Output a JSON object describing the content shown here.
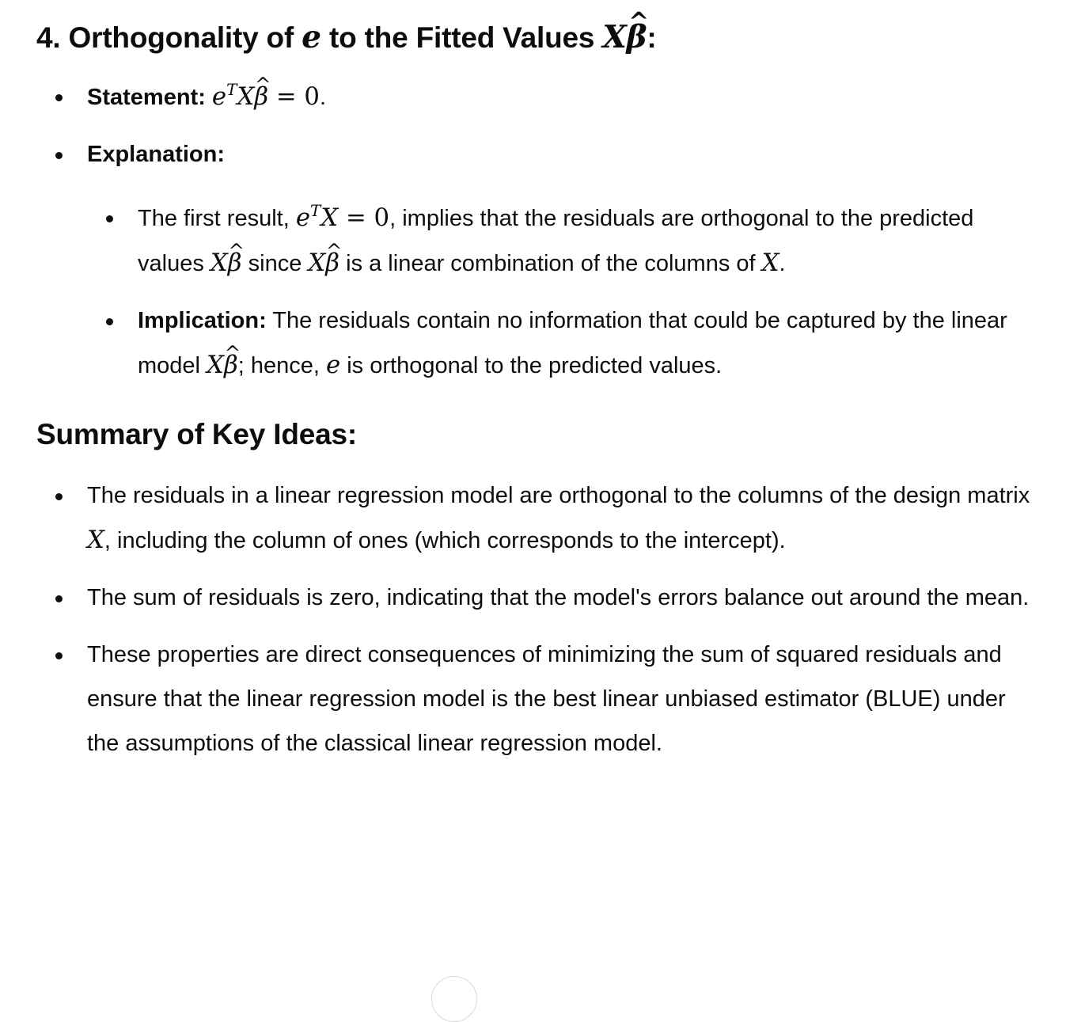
{
  "section4": {
    "heading_prefix": "4. Orthogonality of ",
    "heading_var": "e",
    "heading_mid": " to the Fitted Values ",
    "heading_math_X": "X",
    "heading_math_beta": "β",
    "heading_suffix": ":",
    "statement": {
      "label": "Statement:",
      "math_e": "e",
      "math_sup": "T",
      "math_X": "X",
      "math_beta": "β",
      "math_eq": " = 0",
      "suffix": "."
    },
    "explanation": {
      "label": "Explanation:",
      "items": [
        {
          "t1": "The first result, ",
          "m1_e": "e",
          "m1_sup": "T",
          "m1_X": "X",
          "m1_eq": " = 0",
          "t2": ", implies that the residuals are orthogonal to the predicted values ",
          "m2_X": "X",
          "m2_beta": "β",
          "t3": " since ",
          "m3_X": "X",
          "m3_beta": "β",
          "t4": " is a linear combination of the columns of ",
          "m4_X": "X",
          "t5": "."
        },
        {
          "label": "Implication:",
          "t1": " The residuals contain no information that could be captured by the linear model ",
          "m1_X": "X",
          "m1_beta": "β",
          "t2": "; hence, ",
          "m2_e": "e",
          "t3": " is orthogonal to the predicted values."
        }
      ]
    }
  },
  "summary": {
    "heading": "Summary of Key Ideas:",
    "item1": {
      "t1": "The residuals in a linear regression model are orthogonal to the columns of the design matrix ",
      "m1_X": "X",
      "t2": ", including the column of ones (which corresponds to the intercept)."
    },
    "item2": "The sum of residuals is zero, indicating that the model's errors balance out around the mean.",
    "item3": "These properties are direct consequences of minimizing the sum of squared residuals and ensure that the linear regression model is the best linear unbiased estimator (BLUE) under the assumptions of the classical linear regression model."
  }
}
